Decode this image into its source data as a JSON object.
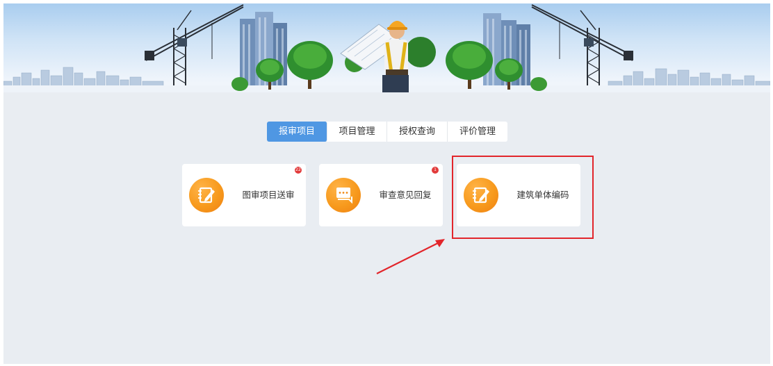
{
  "tabs": [
    {
      "label": "报审项目",
      "active": true
    },
    {
      "label": "项目管理",
      "active": false
    },
    {
      "label": "授权查询",
      "active": false
    },
    {
      "label": "评价管理",
      "active": false
    }
  ],
  "cards": [
    {
      "label": "图审项目送审",
      "icon": "notebook-pencil-icon",
      "badge": "22"
    },
    {
      "label": "审查意见回复",
      "icon": "chat-bubble-icon",
      "badge": "1"
    },
    {
      "label": "建筑单体编码",
      "icon": "notebook-pencil-icon",
      "badge": ""
    }
  ],
  "colors": {
    "accent": "#4f97e3",
    "icon_orange": "#f79a1d",
    "badge_red": "#e23b3b",
    "highlight_red": "#e2252b",
    "background": "#e9edf2"
  }
}
